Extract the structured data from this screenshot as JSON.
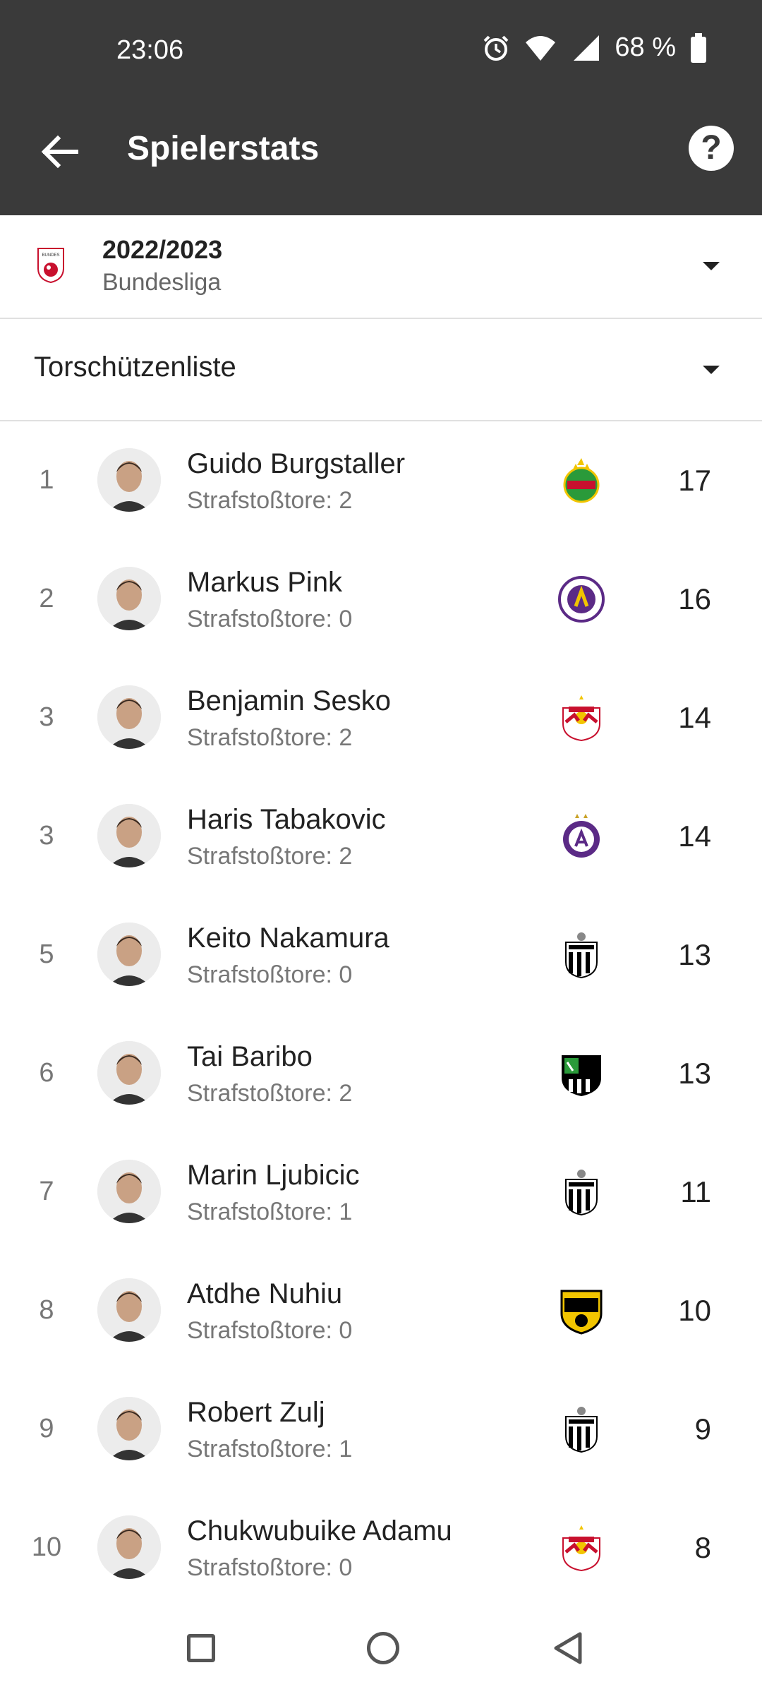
{
  "status_bar": {
    "time": "23:06",
    "battery": "68 %"
  },
  "app_bar": {
    "title": "Spielerstats"
  },
  "season_selector": {
    "year": "2022/2023",
    "league": "Bundesliga"
  },
  "category_selector": {
    "label": "Torschützenliste"
  },
  "players": [
    {
      "rank": "1",
      "name": "Guido Burgstaller",
      "penalties": "Strafstoßtore: 2",
      "goals": "17",
      "club_icon": "rapid-wien-crest"
    },
    {
      "rank": "2",
      "name": "Markus Pink",
      "penalties": "Strafstoßtore: 0",
      "goals": "16",
      "club_icon": "austria-klagenfurt-crest"
    },
    {
      "rank": "3",
      "name": "Benjamin Sesko",
      "penalties": "Strafstoßtore: 2",
      "goals": "14",
      "club_icon": "salzburg-crest"
    },
    {
      "rank": "3",
      "name": "Haris Tabakovic",
      "penalties": "Strafstoßtore: 2",
      "goals": "14",
      "club_icon": "austria-wien-crest"
    },
    {
      "rank": "5",
      "name": "Keito Nakamura",
      "penalties": "Strafstoßtore: 0",
      "goals": "13",
      "club_icon": "lask-crest"
    },
    {
      "rank": "6",
      "name": "Tai Baribo",
      "penalties": "Strafstoßtore: 2",
      "goals": "13",
      "club_icon": "wac-crest"
    },
    {
      "rank": "7",
      "name": "Marin Ljubicic",
      "penalties": "Strafstoßtore: 1",
      "goals": "11",
      "club_icon": "lask-crest"
    },
    {
      "rank": "8",
      "name": "Atdhe Nuhiu",
      "penalties": "Strafstoßtore: 0",
      "goals": "10",
      "club_icon": "scr-altach-crest"
    },
    {
      "rank": "9",
      "name": "Robert Zulj",
      "penalties": "Strafstoßtore: 1",
      "goals": "9",
      "club_icon": "lask-crest"
    },
    {
      "rank": "10",
      "name": "Chukwubuike Adamu",
      "penalties": "Strafstoßtore: 0",
      "goals": "8",
      "club_icon": "salzburg-crest"
    }
  ],
  "colors": {
    "app_bar": "#3a3a3a",
    "divider": "#e0e0e0",
    "primary_text": "#222222",
    "secondary_text": "#777777"
  }
}
